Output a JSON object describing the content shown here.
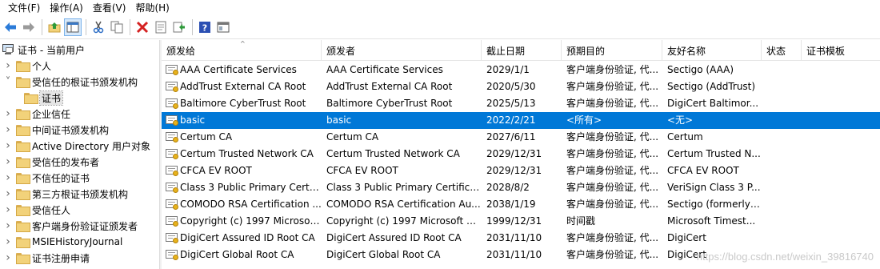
{
  "menu": [
    "文件(F)",
    "操作(A)",
    "查看(V)",
    "帮助(H)"
  ],
  "toolbar": {
    "buttons": [
      "back-arrow-icon",
      "forward-arrow-icon",
      "up-folder-icon",
      "show-hide-tree-icon",
      "cut-icon",
      "copy-icon",
      "delete-icon",
      "properties-icon",
      "export-icon",
      "help-icon",
      "mmc-view-icon"
    ]
  },
  "tree": {
    "root": "证书 - 当前用户",
    "items": [
      {
        "label": "个人",
        "expanded": false
      },
      {
        "label": "受信任的根证书颁发机构",
        "expanded": true
      },
      {
        "label": "证书",
        "child": true,
        "selected": true
      },
      {
        "label": "企业信任",
        "expanded": false
      },
      {
        "label": "中间证书颁发机构",
        "expanded": false
      },
      {
        "label": "Active Directory 用户对象",
        "expanded": false
      },
      {
        "label": "受信任的发布者",
        "expanded": false
      },
      {
        "label": "不信任的证书",
        "expanded": false
      },
      {
        "label": "第三方根证书颁发机构",
        "expanded": false
      },
      {
        "label": "受信任人",
        "expanded": false
      },
      {
        "label": "客户端身份验证证颁发者",
        "expanded": false
      },
      {
        "label": "MSIEHistoryJournal",
        "expanded": false
      },
      {
        "label": "证书注册申请",
        "expanded": false
      }
    ]
  },
  "list": {
    "columns": [
      "颁发给",
      "颁发者",
      "截止日期",
      "预期目的",
      "友好名称",
      "状态",
      "证书模板"
    ],
    "rows": [
      [
        "AAA Certificate Services",
        "AAA Certificate Services",
        "2029/1/1",
        "客户端身份验证, 代...",
        "Sectigo (AAA)",
        "",
        ""
      ],
      [
        "AddTrust External CA Root",
        "AddTrust External CA Root",
        "2020/5/30",
        "客户端身份验证, 代...",
        "Sectigo (AddTrust)",
        "",
        ""
      ],
      [
        "Baltimore CyberTrust Root",
        "Baltimore CyberTrust Root",
        "2025/5/13",
        "客户端身份验证, 代...",
        "DigiCert Baltimor...",
        "",
        ""
      ],
      [
        "basic",
        "basic",
        "2022/2/21",
        "<所有>",
        "<无>",
        "",
        ""
      ],
      [
        "Certum CA",
        "Certum CA",
        "2027/6/11",
        "客户端身份验证, 代...",
        "Certum",
        "",
        ""
      ],
      [
        "Certum Trusted Network CA",
        "Certum Trusted Network CA",
        "2029/12/31",
        "客户端身份验证, 代...",
        "Certum Trusted N...",
        "",
        ""
      ],
      [
        "CFCA EV ROOT",
        "CFCA EV ROOT",
        "2029/12/31",
        "客户端身份验证, 代...",
        "CFCA EV ROOT",
        "",
        ""
      ],
      [
        "Class 3 Public Primary Certifi...",
        "Class 3 Public Primary Certifica...",
        "2028/8/2",
        "客户端身份验证, 代...",
        "VeriSign Class 3 P...",
        "",
        ""
      ],
      [
        "COMODO RSA Certification ...",
        "COMODO RSA Certification Au...",
        "2038/1/19",
        "客户端身份验证, 代...",
        "Sectigo (formerly ...",
        "",
        ""
      ],
      [
        "Copyright (c) 1997 Microsoft...",
        "Copyright (c) 1997 Microsoft C...",
        "1999/12/31",
        "时间戳",
        "Microsoft Timest...",
        "",
        ""
      ],
      [
        "DigiCert Assured ID Root CA",
        "DigiCert Assured ID Root CA",
        "2031/11/10",
        "客户端身份验证, 代...",
        "DigiCert",
        "",
        ""
      ],
      [
        "DigiCert Global Root CA",
        "DigiCert Global Root CA",
        "2031/11/10",
        "客户端身份验证, 代...",
        "DigiCert",
        "",
        ""
      ]
    ],
    "selected_row": 3
  },
  "watermark": "https://blog.csdn.net/weixin_39816740"
}
